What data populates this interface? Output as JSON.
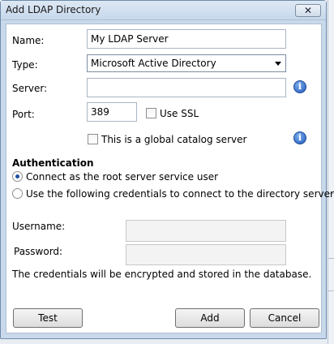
{
  "window": {
    "title": "Add LDAP Directory",
    "close_icon": "close-icon"
  },
  "form": {
    "name_label": "Name:",
    "name_value": "My LDAP Server",
    "type_label": "Type:",
    "type_value": "Microsoft Active Directory",
    "server_label": "Server:",
    "server_value": "",
    "port_label": "Port:",
    "port_value": "389",
    "use_ssl_label": "Use SSL",
    "use_ssl_checked": false,
    "global_catalog_label": "This is a global catalog server",
    "global_catalog_checked": false
  },
  "authentication": {
    "heading": "Authentication",
    "option_root": "Connect as the root server service user",
    "option_credentials": "Use the following credentials to connect to the directory server:",
    "selected": "root",
    "username_label": "Username:",
    "password_label": "Password:",
    "note": "The credentials will be encrypted and stored in the database."
  },
  "buttons": {
    "test": "Test",
    "add": "Add",
    "cancel": "Cancel"
  },
  "colors": {
    "accent": "#2058b8",
    "window_frame": "#c9d9ec"
  }
}
